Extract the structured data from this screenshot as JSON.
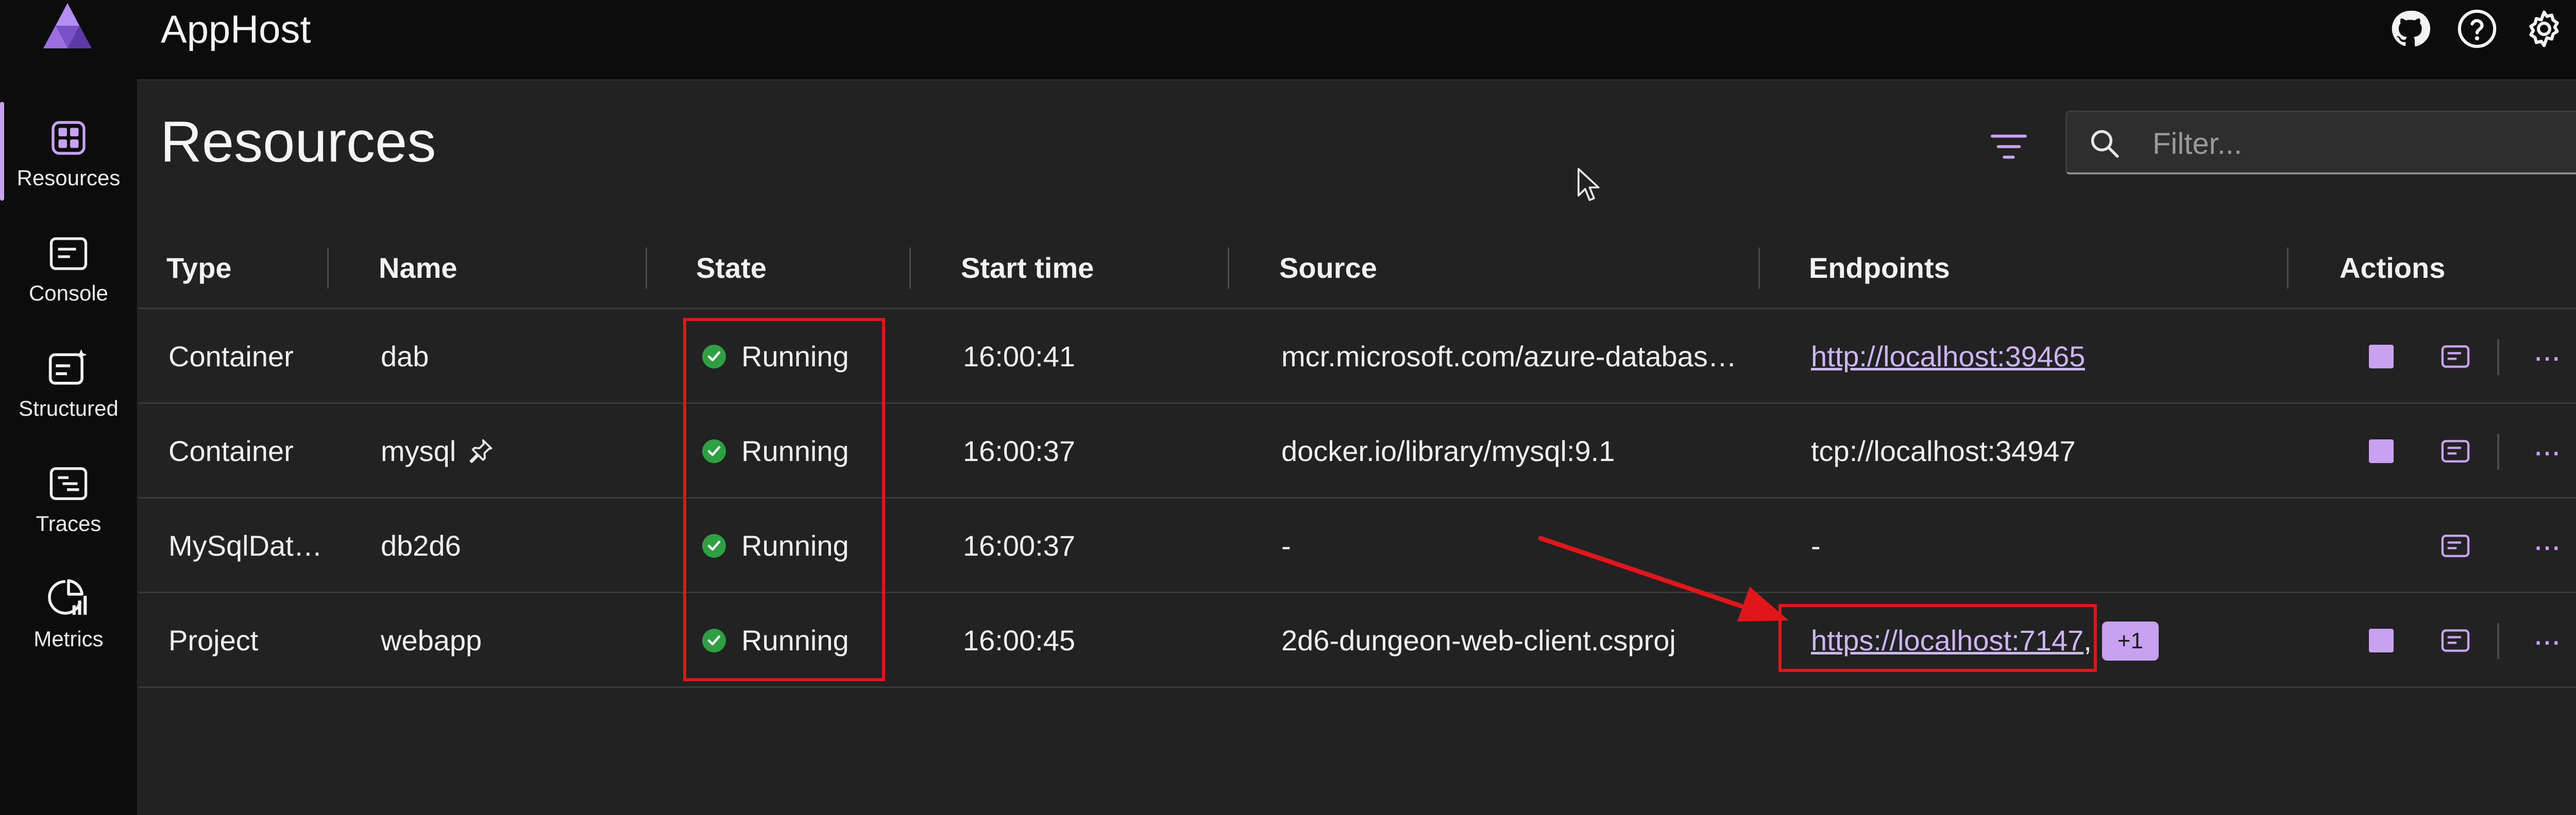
{
  "app": {
    "title": "AppHost"
  },
  "nav": {
    "items": [
      {
        "label": "Resources",
        "icon": "resources-grid-icon",
        "active": true
      },
      {
        "label": "Console",
        "icon": "console-icon"
      },
      {
        "label": "Structured",
        "icon": "structured-logs-icon"
      },
      {
        "label": "Traces",
        "icon": "traces-icon"
      },
      {
        "label": "Metrics",
        "icon": "metrics-icon"
      }
    ]
  },
  "header_icons": [
    "github-icon",
    "help-icon",
    "settings-icon"
  ],
  "page": {
    "title": "Resources",
    "filter_icon": "filter-icon",
    "search": {
      "placeholder": "Filter...",
      "value": ""
    }
  },
  "table": {
    "columns": [
      "Type",
      "Name",
      "State",
      "Start time",
      "Source",
      "Endpoints",
      "Actions"
    ],
    "rows": [
      {
        "type": "Container",
        "name": "dab",
        "pinned": false,
        "state": "Running",
        "start_time": "16:00:41",
        "source": "mcr.microsoft.com/azure-databas…",
        "endpoint": "http://localhost:39465",
        "endpoint_is_link": true,
        "extra": "",
        "has_stop": true
      },
      {
        "type": "Container",
        "name": "mysql",
        "pinned": true,
        "state": "Running",
        "start_time": "16:00:37",
        "source": "docker.io/library/mysql:9.1",
        "endpoint": "tcp://localhost:34947",
        "endpoint_is_link": false,
        "extra": "",
        "has_stop": true
      },
      {
        "type": "MySqlDat…",
        "name": "db2d6",
        "pinned": false,
        "state": "Running",
        "start_time": "16:00:37",
        "source": "-",
        "endpoint": "-",
        "endpoint_is_link": false,
        "extra": "",
        "has_stop": false
      },
      {
        "type": "Project",
        "name": "webapp",
        "pinned": false,
        "state": "Running",
        "start_time": "16:00:45",
        "source": "2d6-dungeon-web-client.csproj",
        "endpoint": "https://localhost:7147",
        "endpoint_is_link": true,
        "extra": "+1",
        "has_stop": true
      }
    ]
  },
  "colors": {
    "accent": "#c8a2f0",
    "running": "#2ea043",
    "annotation": "#e0161a",
    "panel": "#222222",
    "chrome": "#0c0c0c"
  }
}
